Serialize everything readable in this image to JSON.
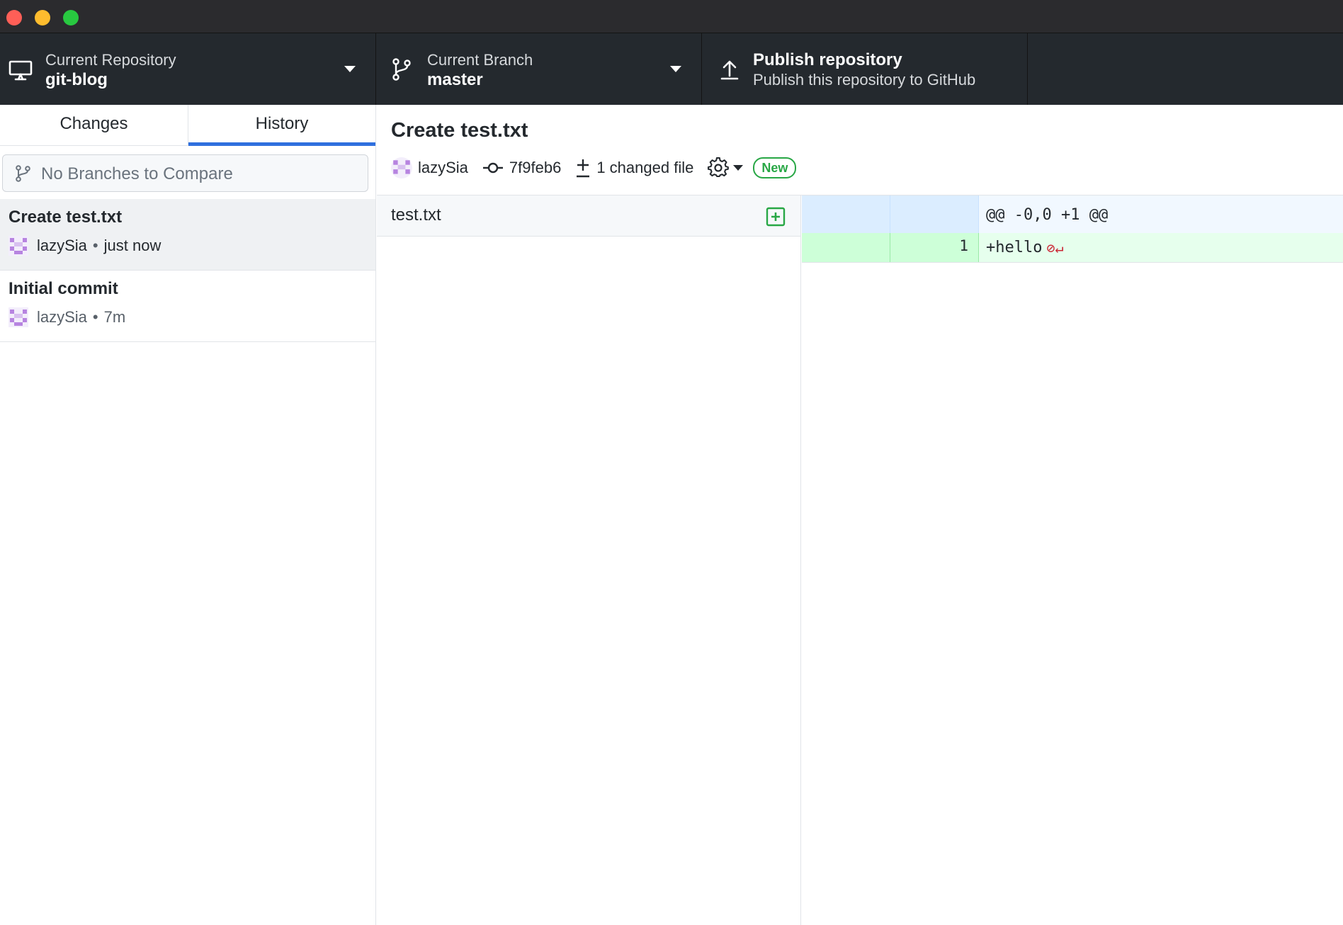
{
  "toolbar": {
    "repository": {
      "label": "Current Repository",
      "value": "git-blog"
    },
    "branch": {
      "label": "Current Branch",
      "value": "master"
    },
    "publish": {
      "label": "Publish repository",
      "value": "Publish this repository to GitHub"
    }
  },
  "sidebar": {
    "tabs": [
      {
        "label": "Changes",
        "selected": false
      },
      {
        "label": "History",
        "selected": true
      }
    ],
    "compare_placeholder": "No Branches to Compare",
    "commits": [
      {
        "title": "Create test.txt",
        "author": "lazySia",
        "separator": "•",
        "time": "just now",
        "selected": true
      },
      {
        "title": "Initial commit",
        "author": "lazySia",
        "separator": "•",
        "time": "7m",
        "selected": false
      }
    ]
  },
  "commit_detail": {
    "title": "Create test.txt",
    "author": "lazySia",
    "sha": "7f9feb6",
    "changed_files": "1 changed file",
    "badge": "New"
  },
  "files": [
    {
      "name": "test.txt",
      "status": "added"
    }
  ],
  "diff": {
    "hunk_header": "@@ -0,0 +1 @@",
    "lines": [
      {
        "old": "",
        "new": "1",
        "text": "+hello",
        "no_newline_marker": "⊘↵"
      }
    ]
  },
  "colors": {
    "toolbar_bg": "#24292e",
    "tab_selected": "#2f6fde",
    "added": "#28a745",
    "diff_add_bg": "#e6ffed",
    "hunk_bg": "#f1f8ff"
  }
}
